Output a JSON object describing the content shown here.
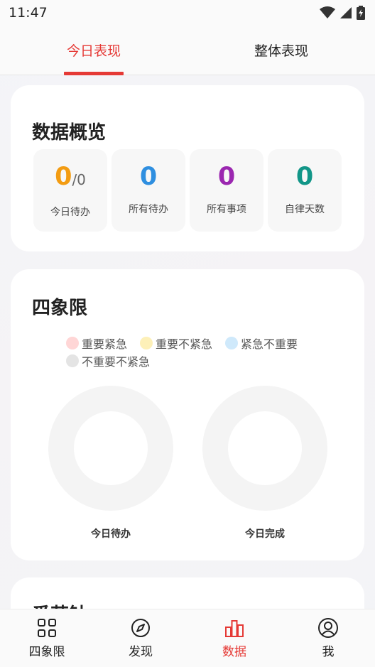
{
  "status_bar": {
    "time": "11:47"
  },
  "tabs": [
    {
      "label": "今日表现",
      "active": true
    },
    {
      "label": "整体表现",
      "active": false
    }
  ],
  "overview": {
    "title": "数据概览",
    "stats": [
      {
        "value": "0",
        "sub": "/0",
        "label": "今日待办",
        "color": "#f39c12"
      },
      {
        "value": "0",
        "sub": "",
        "label": "所有待办",
        "color": "#2f8fe0"
      },
      {
        "value": "0",
        "sub": "",
        "label": "所有事项",
        "color": "#9b27b0"
      },
      {
        "value": "0",
        "sub": "",
        "label": "自律天数",
        "color": "#129688"
      }
    ]
  },
  "quadrant": {
    "title": "四象限",
    "legend": [
      {
        "label": "重要紧急",
        "color": "#ffd6d6"
      },
      {
        "label": "重要不紧急",
        "color": "#fdf0b8"
      },
      {
        "label": "紧急不重要",
        "color": "#cfe9fb"
      },
      {
        "label": "不重要不紧急",
        "color": "#e4e4e4"
      }
    ],
    "charts": [
      {
        "label": "今日待办",
        "value": 0
      },
      {
        "label": "今日完成",
        "value": 0
      }
    ]
  },
  "next_card": {
    "title": "番茄钟"
  },
  "bottom_nav": [
    {
      "label": "四象限",
      "icon": "grid-icon",
      "active": false
    },
    {
      "label": "发现",
      "icon": "compass-icon",
      "active": false
    },
    {
      "label": "数据",
      "icon": "bar-chart-icon",
      "active": true
    },
    {
      "label": "我",
      "icon": "user-icon",
      "active": false
    }
  ],
  "colors": {
    "accent": "#e53935"
  }
}
